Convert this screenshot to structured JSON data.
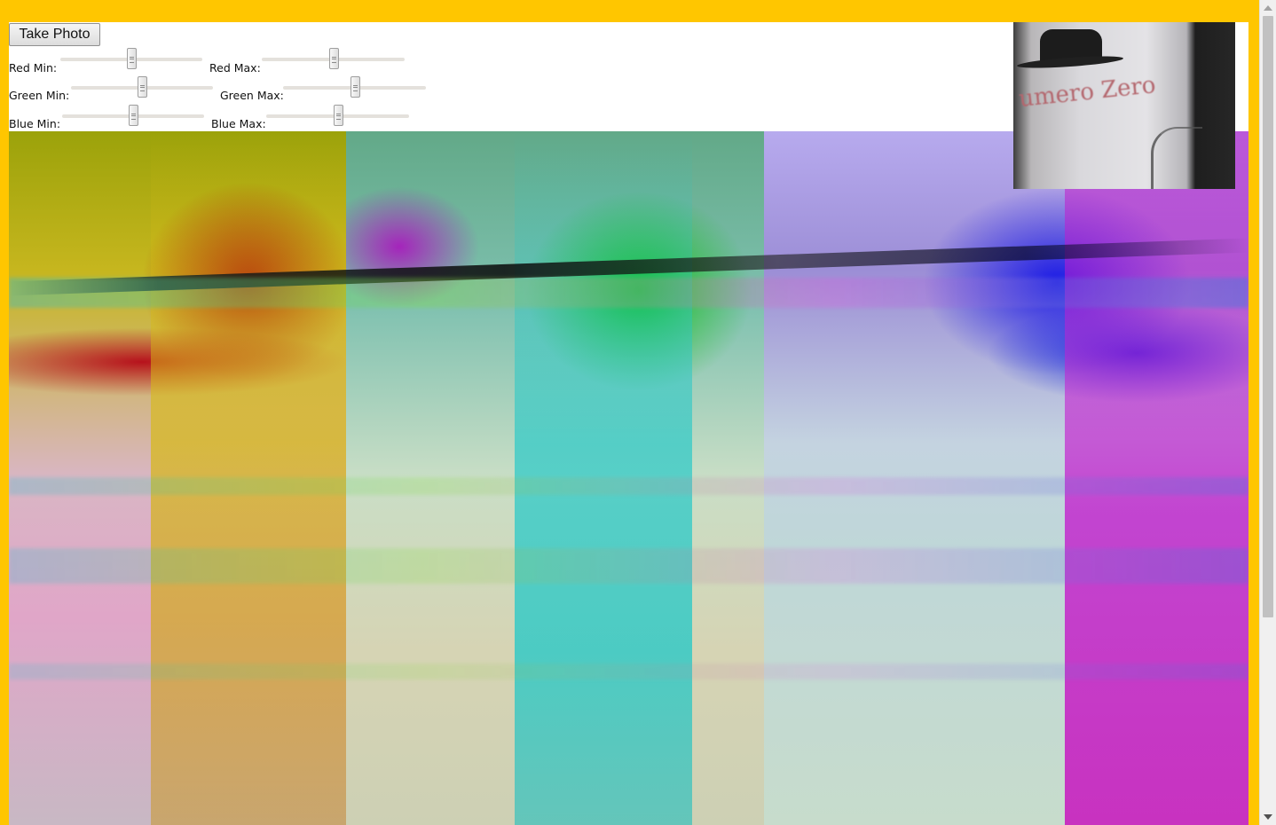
{
  "toolbar": {
    "take_photo_label": "Take Photo"
  },
  "sliders": {
    "red_min": {
      "label": "Red Min:",
      "value": 0.5
    },
    "red_max": {
      "label": "Red Max:",
      "value": 0.5
    },
    "green_min": {
      "label": "Green Min:",
      "value": 0.5
    },
    "green_max": {
      "label": "Green Max:",
      "value": 0.5
    },
    "blue_min": {
      "label": "Blue Min:",
      "value": 0.5
    },
    "blue_max": {
      "label": "Blue Max:",
      "value": 0.5
    }
  },
  "preview": {
    "caption_text": "umero Zero"
  },
  "colors": {
    "page_background": "#ffc600",
    "canvas_background": "#ffffff"
  }
}
